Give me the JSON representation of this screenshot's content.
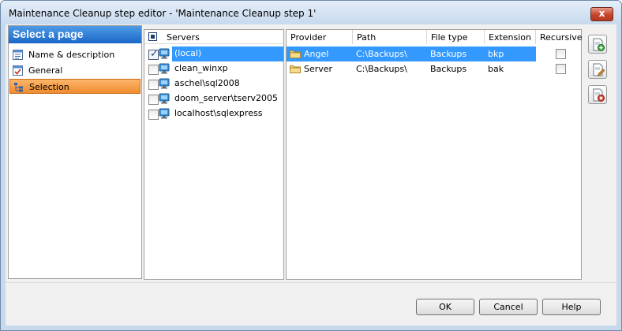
{
  "window": {
    "title": "Maintenance Cleanup step editor - 'Maintenance Cleanup step 1'",
    "close_label": "x"
  },
  "left_pane": {
    "header": "Select a page",
    "items": [
      {
        "label": "Name & description",
        "icon": "name-description-icon",
        "selected": false
      },
      {
        "label": "General",
        "icon": "general-icon",
        "selected": false
      },
      {
        "label": "Selection",
        "icon": "selection-icon",
        "selected": true
      }
    ]
  },
  "servers": {
    "header": "Servers",
    "rows": [
      {
        "label": "(local)",
        "checked": true,
        "selected": true
      },
      {
        "label": "clean_winxp",
        "checked": false,
        "selected": false
      },
      {
        "label": "aschel\\sql2008",
        "checked": false,
        "selected": false
      },
      {
        "label": "doom_server\\tserv2005",
        "checked": false,
        "selected": false
      },
      {
        "label": "localhost\\sqlexpress",
        "checked": false,
        "selected": false
      }
    ]
  },
  "providers": {
    "columns": [
      "Provider",
      "Path",
      "File type",
      "Extension",
      "Recursive"
    ],
    "rows": [
      {
        "provider": "Angel",
        "path": "C:\\Backups\\",
        "file_type": "Backups",
        "extension": "bkp",
        "recursive": false,
        "selected": true
      },
      {
        "provider": "Server",
        "path": "C:\\Backups\\",
        "file_type": "Backups",
        "extension": "bak",
        "recursive": false,
        "selected": false
      }
    ]
  },
  "side_buttons": [
    {
      "name": "add-provider-button",
      "icon": "add-document-icon"
    },
    {
      "name": "edit-provider-button",
      "icon": "edit-document-icon"
    },
    {
      "name": "delete-provider-button",
      "icon": "delete-document-icon"
    }
  ],
  "buttons": {
    "ok": "OK",
    "cancel": "Cancel",
    "help": "Help"
  },
  "colors": {
    "selection_blue": "#3399ff",
    "nav_selected": "#f08c2e",
    "header_blue": "#1a67c8"
  }
}
